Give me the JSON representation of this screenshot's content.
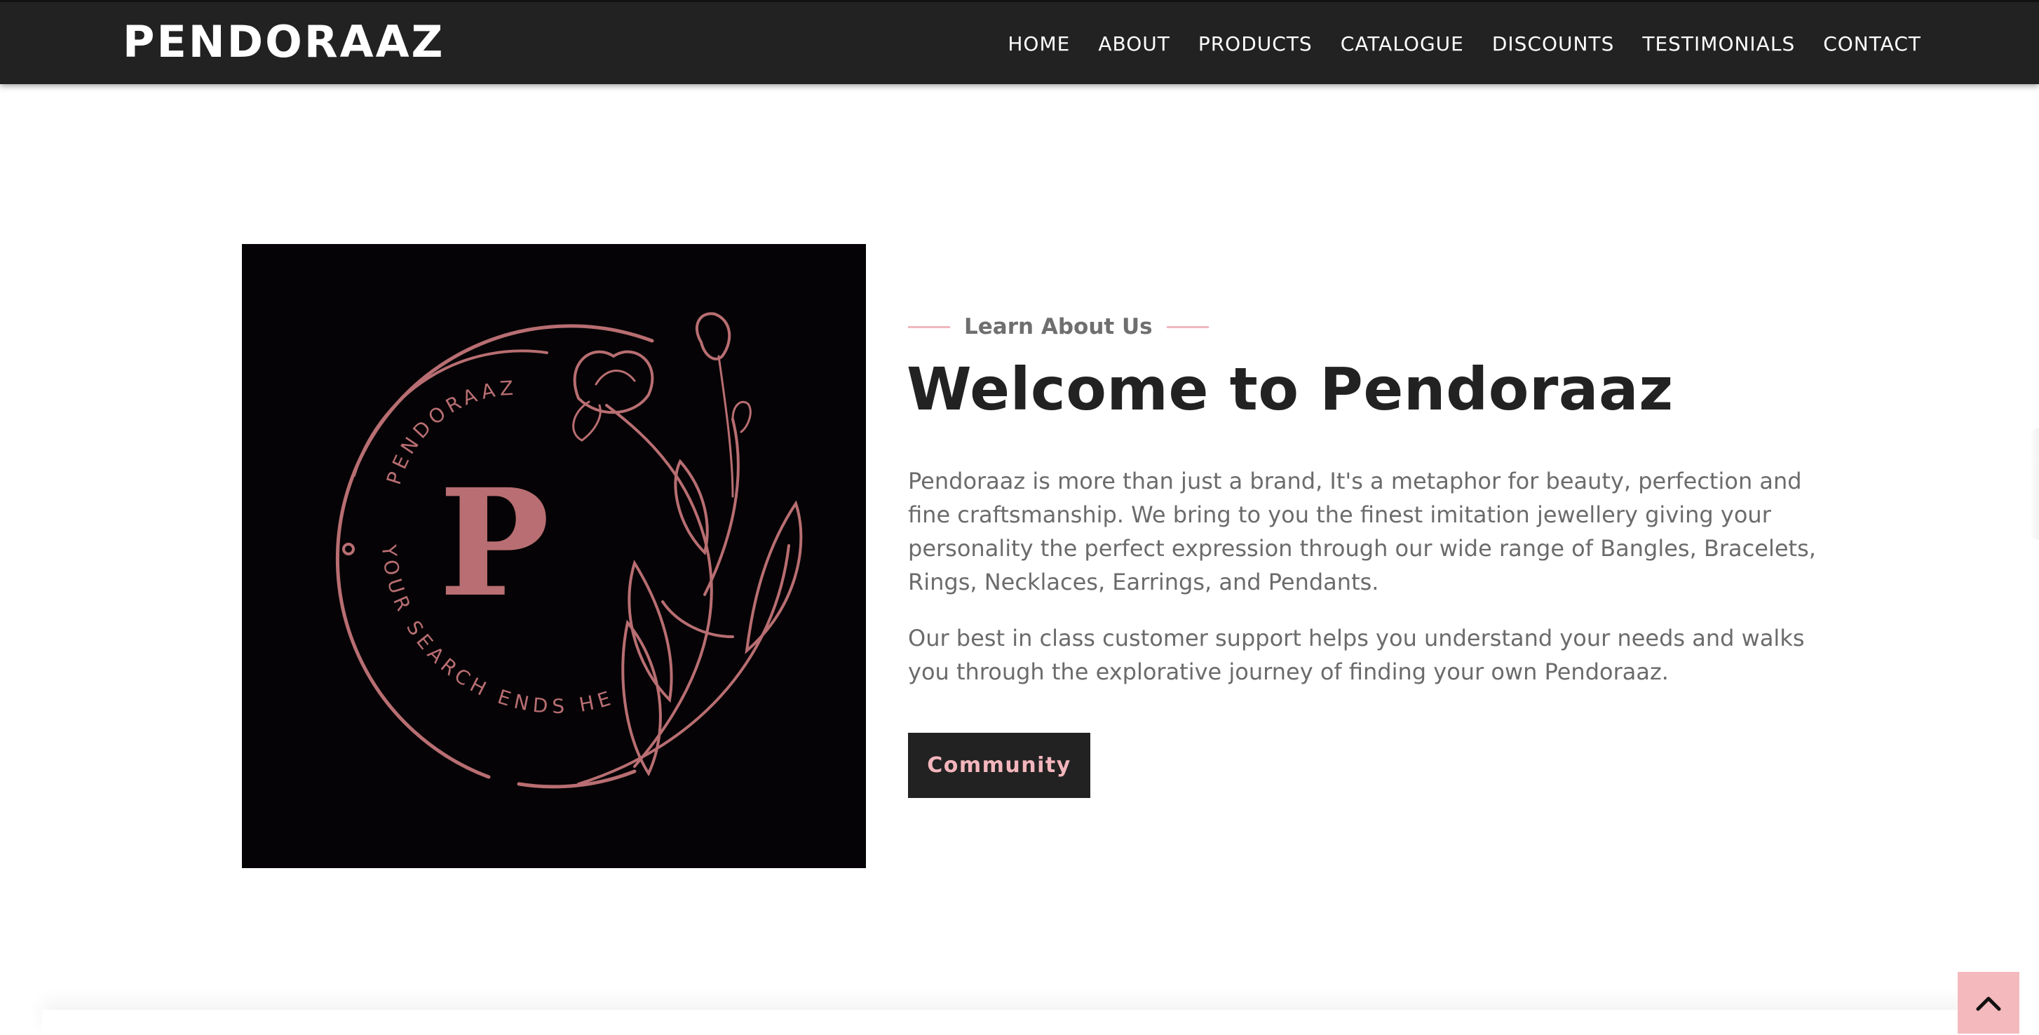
{
  "header": {
    "logo": "PENDORAAZ",
    "nav": [
      {
        "label": "HOME"
      },
      {
        "label": "ABOUT"
      },
      {
        "label": "PRODUCTS"
      },
      {
        "label": "CATALOGUE"
      },
      {
        "label": "DISCOUNTS"
      },
      {
        "label": "TESTIMONIALS"
      },
      {
        "label": "CONTACT"
      }
    ]
  },
  "about": {
    "tag": "Learn About Us",
    "title": "Welcome to Pendoraaz",
    "paragraphs": [
      "Pendoraaz is more than just a brand, It's a metaphor for beauty, perfection and fine craftsmanship. We bring to you the finest imitation jewellery giving your personality the perfect expression through our wide range of Bangles, Bracelets, Rings, Necklaces, Earrings, and Pendants.",
      "Our best in class customer support helps you understand your needs and walks you through the explorative journey of finding your own Pendoraaz."
    ],
    "button_label": "Community",
    "logo_image": {
      "letter": "P",
      "arc_top_text": "PENDORAAZ",
      "arc_bottom_text": "YOUR SEARCH ENDS HERE"
    }
  },
  "icons": {
    "back_to_top": "chevron-up-icon"
  },
  "colors": {
    "header_bg": "#222222",
    "accent_pink": "#f3b6bc",
    "logo_rose": "#b86e72",
    "text_dark": "#222222",
    "text_body": "#6b6b6b"
  }
}
